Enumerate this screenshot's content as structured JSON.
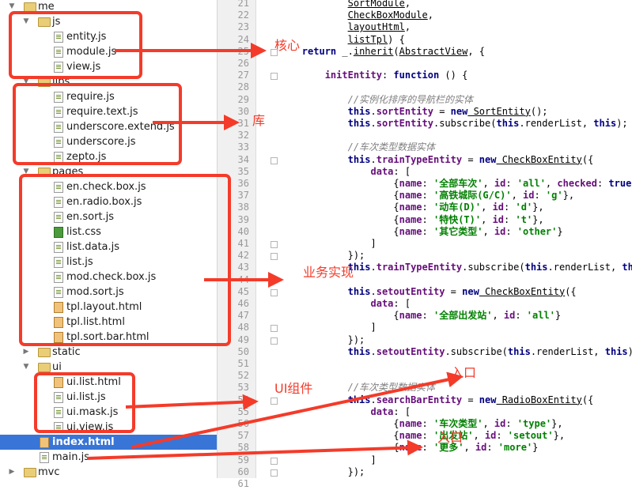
{
  "project_tree": {
    "rows": [
      {
        "label": "me",
        "depth": 0,
        "kind": "folder",
        "expanded": true,
        "selected": false
      },
      {
        "label": "js",
        "depth": 1,
        "kind": "folder",
        "expanded": true,
        "selected": false
      },
      {
        "label": "entity.js",
        "depth": 2,
        "kind": "js",
        "selected": false
      },
      {
        "label": "module.js",
        "depth": 2,
        "kind": "js",
        "selected": false
      },
      {
        "label": "view.js",
        "depth": 2,
        "kind": "js",
        "selected": false
      },
      {
        "label": "libs",
        "depth": 1,
        "kind": "folder",
        "expanded": true,
        "selected": false
      },
      {
        "label": "require.js",
        "depth": 2,
        "kind": "js",
        "selected": false
      },
      {
        "label": "require.text.js",
        "depth": 2,
        "kind": "js",
        "selected": false
      },
      {
        "label": "underscore.extend.js",
        "depth": 2,
        "kind": "js",
        "selected": false
      },
      {
        "label": "underscore.js",
        "depth": 2,
        "kind": "js",
        "selected": false
      },
      {
        "label": "zepto.js",
        "depth": 2,
        "kind": "js",
        "selected": false
      },
      {
        "label": "pages",
        "depth": 1,
        "kind": "folder",
        "expanded": true,
        "selected": false
      },
      {
        "label": "en.check.box.js",
        "depth": 2,
        "kind": "js",
        "selected": false
      },
      {
        "label": "en.radio.box.js",
        "depth": 2,
        "kind": "js",
        "selected": false
      },
      {
        "label": "en.sort.js",
        "depth": 2,
        "kind": "js",
        "selected": false
      },
      {
        "label": "list.css",
        "depth": 2,
        "kind": "css",
        "selected": false
      },
      {
        "label": "list.data.js",
        "depth": 2,
        "kind": "js",
        "selected": false
      },
      {
        "label": "list.js",
        "depth": 2,
        "kind": "js",
        "selected": false
      },
      {
        "label": "mod.check.box.js",
        "depth": 2,
        "kind": "js",
        "selected": false
      },
      {
        "label": "mod.sort.js",
        "depth": 2,
        "kind": "js",
        "selected": false
      },
      {
        "label": "tpl.layout.html",
        "depth": 2,
        "kind": "html",
        "selected": false
      },
      {
        "label": "tpl.list.html",
        "depth": 2,
        "kind": "html",
        "selected": false
      },
      {
        "label": "tpl.sort.bar.html",
        "depth": 2,
        "kind": "html",
        "selected": false
      },
      {
        "label": "static",
        "depth": 1,
        "kind": "folder",
        "expanded": false,
        "selected": false
      },
      {
        "label": "ui",
        "depth": 1,
        "kind": "folder",
        "expanded": true,
        "selected": false
      },
      {
        "label": "ui.list.html",
        "depth": 2,
        "kind": "html",
        "selected": false
      },
      {
        "label": "ui.list.js",
        "depth": 2,
        "kind": "js",
        "selected": false
      },
      {
        "label": "ui.mask.js",
        "depth": 2,
        "kind": "js",
        "selected": false
      },
      {
        "label": "ui.view.js",
        "depth": 2,
        "kind": "js",
        "selected": false
      },
      {
        "label": "index.html",
        "depth": 1,
        "kind": "html",
        "selected": true
      },
      {
        "label": "main.js",
        "depth": 1,
        "kind": "js",
        "selected": false
      },
      {
        "label": "mvc",
        "depth": 0,
        "kind": "folder",
        "expanded": false,
        "selected": false
      }
    ]
  },
  "editor": {
    "first_line_number": 21,
    "lines": [
      [
        [
          "",
          "                "
        ],
        [
          "ul",
          "SortModule"
        ],
        [
          "",
          ","
        ]
      ],
      [
        [
          "",
          "                "
        ],
        [
          "ul",
          "CheckBoxModule"
        ],
        [
          "",
          ","
        ]
      ],
      [
        [
          "",
          "                "
        ],
        [
          "ul",
          "layoutHtml"
        ],
        [
          "",
          ","
        ]
      ],
      [
        [
          "",
          "                "
        ],
        [
          "ul",
          "listTpl"
        ],
        [
          "",
          ") {"
        ]
      ],
      [
        [
          "",
          "        "
        ],
        [
          "kw",
          "return"
        ],
        [
          "",
          " _."
        ],
        [
          "ul",
          "inherit"
        ],
        [
          "",
          "("
        ],
        [
          "ul",
          "AbstractView"
        ],
        [
          "",
          ", {"
        ]
      ],
      [
        [
          "",
          ""
        ]
      ],
      [
        [
          "",
          "            "
        ],
        [
          "pr",
          "initEntity"
        ],
        [
          "",
          ": "
        ],
        [
          "kw",
          "function"
        ],
        [
          "",
          " () {"
        ]
      ],
      [
        [
          "",
          ""
        ]
      ],
      [
        [
          "",
          "                "
        ],
        [
          "cm",
          "//实例化排序的导航栏的实体"
        ]
      ],
      [
        [
          "",
          "                "
        ],
        [
          "kw",
          "this"
        ],
        [
          "",
          "."
        ],
        [
          "pr",
          "sortEntity"
        ],
        [
          "",
          " = "
        ],
        [
          "kw",
          "new"
        ],
        [
          "",
          ""
        ],
        [
          "ul",
          " SortEntity"
        ],
        [
          "",
          "();"
        ]
      ],
      [
        [
          "",
          "                "
        ],
        [
          "kw",
          "this"
        ],
        [
          "",
          "."
        ],
        [
          "pr",
          "sortEntity"
        ],
        [
          "",
          ".subscribe("
        ],
        [
          "kw",
          "this"
        ],
        [
          "",
          ".renderList, "
        ],
        [
          "kw",
          "this"
        ],
        [
          "",
          ");"
        ]
      ],
      [
        [
          "",
          ""
        ]
      ],
      [
        [
          "",
          "                "
        ],
        [
          "cm",
          "//车次类型数据实体"
        ]
      ],
      [
        [
          "",
          "                "
        ],
        [
          "kw",
          "this"
        ],
        [
          "",
          "."
        ],
        [
          "pr",
          "trainTypeEntity"
        ],
        [
          "",
          " = "
        ],
        [
          "kw",
          "new"
        ],
        [
          "",
          ""
        ],
        [
          "ul",
          " CheckBoxEntity"
        ],
        [
          "",
          "({"
        ]
      ],
      [
        [
          "",
          "                    "
        ],
        [
          "pr",
          "data"
        ],
        [
          "",
          ": ["
        ]
      ],
      [
        [
          "",
          "                        {"
        ],
        [
          "pr",
          "name"
        ],
        [
          "",
          ": "
        ],
        [
          "st",
          "'全部车次'"
        ],
        [
          "",
          ", "
        ],
        [
          "pr",
          "id"
        ],
        [
          "",
          ": "
        ],
        [
          "st",
          "'all'"
        ],
        [
          "",
          ", "
        ],
        [
          "pr",
          "checked"
        ],
        [
          "",
          ": "
        ],
        [
          "kw",
          "true"
        ],
        [
          "",
          "},"
        ]
      ],
      [
        [
          "",
          "                        {"
        ],
        [
          "pr",
          "name"
        ],
        [
          "",
          ": "
        ],
        [
          "st",
          "'高铁城际(G/C)'"
        ],
        [
          "",
          ", "
        ],
        [
          "pr",
          "id"
        ],
        [
          "",
          ": "
        ],
        [
          "st",
          "'g'"
        ],
        [
          "",
          "},"
        ]
      ],
      [
        [
          "",
          "                        {"
        ],
        [
          "pr",
          "name"
        ],
        [
          "",
          ": "
        ],
        [
          "st",
          "'动车(D)'"
        ],
        [
          "",
          ", "
        ],
        [
          "pr",
          "id"
        ],
        [
          "",
          ": "
        ],
        [
          "st",
          "'d'"
        ],
        [
          "",
          "},"
        ]
      ],
      [
        [
          "",
          "                        {"
        ],
        [
          "pr",
          "name"
        ],
        [
          "",
          ": "
        ],
        [
          "st",
          "'特快(T)'"
        ],
        [
          "",
          ", "
        ],
        [
          "pr",
          "id"
        ],
        [
          "",
          ": "
        ],
        [
          "st",
          "'t'"
        ],
        [
          "",
          "},"
        ]
      ],
      [
        [
          "",
          "                        {"
        ],
        [
          "pr",
          "name"
        ],
        [
          "",
          ": "
        ],
        [
          "st",
          "'其它类型'"
        ],
        [
          "",
          ", "
        ],
        [
          "pr",
          "id"
        ],
        [
          "",
          ": "
        ],
        [
          "st",
          "'other'"
        ],
        [
          "",
          "}"
        ]
      ],
      [
        [
          "",
          "                    ]"
        ]
      ],
      [
        [
          "",
          "                });"
        ]
      ],
      [
        [
          "",
          "                "
        ],
        [
          "kw",
          "this"
        ],
        [
          "",
          "."
        ],
        [
          "pr",
          "trainTypeEntity"
        ],
        [
          "",
          ".subscribe("
        ],
        [
          "kw",
          "this"
        ],
        [
          "",
          ".renderList, "
        ],
        [
          "kw",
          "this"
        ]
      ],
      [
        [
          "",
          ""
        ]
      ],
      [
        [
          "",
          "                "
        ],
        [
          "kw",
          "this"
        ],
        [
          "",
          "."
        ],
        [
          "pr",
          "setoutEntity"
        ],
        [
          "",
          " = "
        ],
        [
          "kw",
          "new"
        ],
        [
          "",
          ""
        ],
        [
          "ul",
          " CheckBoxEntity"
        ],
        [
          "",
          "({"
        ]
      ],
      [
        [
          "",
          "                    "
        ],
        [
          "pr",
          "data"
        ],
        [
          "",
          ": ["
        ]
      ],
      [
        [
          "",
          "                        {"
        ],
        [
          "pr",
          "name"
        ],
        [
          "",
          ": "
        ],
        [
          "st",
          "'全部出发站'"
        ],
        [
          "",
          ", "
        ],
        [
          "pr",
          "id"
        ],
        [
          "",
          ": "
        ],
        [
          "st",
          "'all'"
        ],
        [
          "",
          "}"
        ]
      ],
      [
        [
          "",
          "                    ]"
        ]
      ],
      [
        [
          "",
          "                });"
        ]
      ],
      [
        [
          "",
          "                "
        ],
        [
          "kw",
          "this"
        ],
        [
          "",
          "."
        ],
        [
          "pr",
          "setoutEntity"
        ],
        [
          "",
          ".subscribe("
        ],
        [
          "kw",
          "this"
        ],
        [
          "",
          ".renderList, "
        ],
        [
          "kw",
          "this"
        ],
        [
          "",
          ")"
        ]
      ],
      [
        [
          "",
          ""
        ]
      ],
      [
        [
          "",
          ""
        ]
      ],
      [
        [
          "",
          "                "
        ],
        [
          "cm",
          "//车次类型数据实体"
        ]
      ],
      [
        [
          "",
          "                "
        ],
        [
          "kw",
          "this"
        ],
        [
          "",
          "."
        ],
        [
          "pr",
          "searchBarEntity"
        ],
        [
          "",
          " = "
        ],
        [
          "kw",
          "new"
        ],
        [
          "",
          ""
        ],
        [
          "ul",
          " RadioBoxEntity"
        ],
        [
          "",
          "({"
        ]
      ],
      [
        [
          "",
          "                    "
        ],
        [
          "pr",
          "data"
        ],
        [
          "",
          ": ["
        ]
      ],
      [
        [
          "",
          "                        {"
        ],
        [
          "pr",
          "name"
        ],
        [
          "",
          ": "
        ],
        [
          "st",
          "'车次类型'"
        ],
        [
          "",
          ", "
        ],
        [
          "pr",
          "id"
        ],
        [
          "",
          ": "
        ],
        [
          "st",
          "'type'"
        ],
        [
          "",
          "},"
        ]
      ],
      [
        [
          "",
          "                        {"
        ],
        [
          "pr",
          "name"
        ],
        [
          "",
          ": "
        ],
        [
          "st",
          "'出发站'"
        ],
        [
          "",
          ", "
        ],
        [
          "pr",
          "id"
        ],
        [
          "",
          ": "
        ],
        [
          "st",
          "'setout'"
        ],
        [
          "",
          "},"
        ]
      ],
      [
        [
          "",
          "                        {"
        ],
        [
          "pr",
          "name"
        ],
        [
          "",
          ": "
        ],
        [
          "st",
          "'更多'"
        ],
        [
          "",
          ", "
        ],
        [
          "pr",
          "id"
        ],
        [
          "",
          ": "
        ],
        [
          "st",
          "'more'"
        ],
        [
          "",
          "}"
        ]
      ],
      [
        [
          "",
          "                    ]"
        ]
      ],
      [
        [
          "",
          "                });"
        ]
      ],
      [
        [
          "",
          "                "
        ],
        [
          "kw",
          "this"
        ],
        [
          "",
          "."
        ],
        [
          "pr",
          "searchBarEntity"
        ],
        [
          "",
          ".subscribe("
        ],
        [
          "kw",
          "this"
        ],
        [
          "",
          ".renderSearchBar"
        ]
      ]
    ]
  },
  "annotations": {
    "core": "核心",
    "libs": "库",
    "business": "业务实现",
    "ui_components": "UI组件",
    "entry_1": "入口",
    "entry_2": "入口"
  },
  "colors": {
    "annotation_red": "#f43b2a",
    "selection_blue": "#3875d7",
    "keyword": "#000080",
    "property": "#660e7a",
    "string": "#008000",
    "comment": "#808080"
  }
}
